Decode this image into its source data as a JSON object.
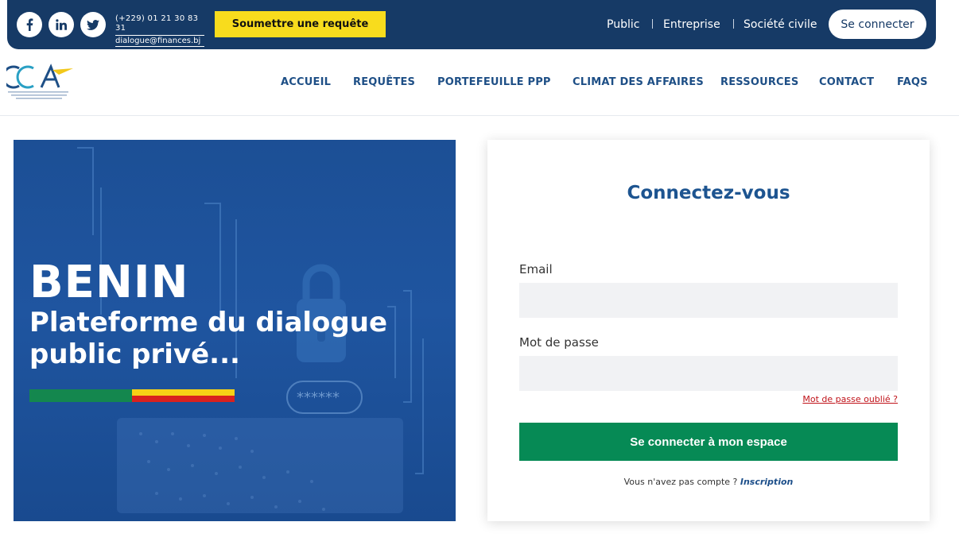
{
  "topbar": {
    "social": [
      "facebook-icon",
      "linkedin-icon",
      "twitter-icon"
    ],
    "phone": "(+229) 01 21 30 83 31",
    "email": "dialogue@finances.bj",
    "submit_label": "Soumettre une requête",
    "audiences": [
      "Public",
      "Entreprise",
      "Société civile"
    ],
    "login_label": "Se connecter"
  },
  "header": {
    "logo_text": "CCA",
    "logo_caption": "Cellule de mise en œuvre du climat des affaires et du dialogue",
    "nav": [
      "ACCUEIL",
      "REQUÊTES",
      "PORTEFEUILLE PPP",
      "CLIMAT DES AFFAIRES",
      "RESSOURCES",
      "CONTACT",
      "FAQS"
    ]
  },
  "hero": {
    "title": "BENIN",
    "subtitle": "Plateforme du dialogue public privé...",
    "flag_colors": [
      "#14874e",
      "#f6d116",
      "#d9211e"
    ]
  },
  "login": {
    "title": "Connectez-vous",
    "email_label": "Email",
    "email_value": "",
    "password_label": "Mot de passe",
    "password_value": "",
    "forgot_label": "Mot de passe oublié ?",
    "submit_label": "Se connecter à mon espace",
    "no_account_text": "Vous n'avez pas compte ?",
    "signup_label": "Inscription"
  },
  "colors": {
    "primary": "#163a66",
    "accent_yellow": "#f8dc1d",
    "success_green": "#068a55",
    "link_red": "#c0131a"
  }
}
